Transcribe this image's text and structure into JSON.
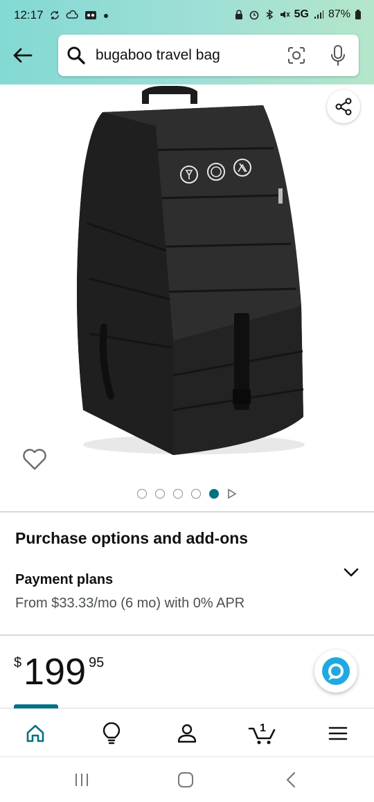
{
  "status_bar": {
    "time": "12:17",
    "network": "5G",
    "battery": "87%"
  },
  "search": {
    "query": "bugaboo travel bag"
  },
  "gallery": {
    "image_count": 5,
    "active_index": 4,
    "icons": [
      "share-icon",
      "heart-icon",
      "play-next-icon"
    ]
  },
  "purchase": {
    "title": "Purchase options and add-ons",
    "payment_title": "Payment plans",
    "payment_detail": "From $33.33/mo (6 mo) with 0% APR"
  },
  "price": {
    "symbol": "$",
    "whole": "199",
    "fraction": "95"
  },
  "bottom_nav": {
    "items": [
      "home",
      "inspire",
      "account",
      "cart",
      "menu"
    ],
    "cart_count": "1"
  },
  "colors": {
    "accent": "#007185",
    "header_gradient_start": "#83d9d4",
    "header_gradient_end": "#b4e6c9"
  }
}
